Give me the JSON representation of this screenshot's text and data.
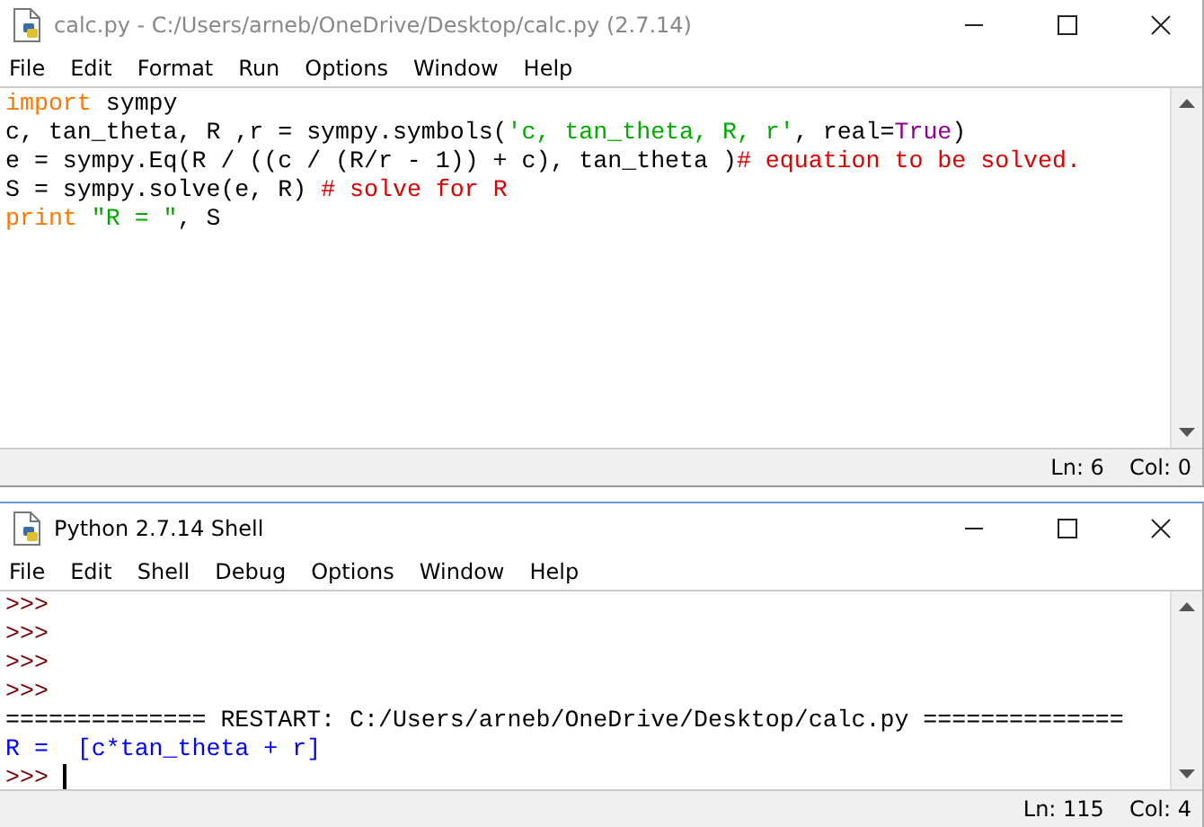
{
  "editor": {
    "title": "calc.py - C:/Users/arneb/OneDrive/Desktop/calc.py (2.7.14)",
    "menu": [
      "File",
      "Edit",
      "Format",
      "Run",
      "Options",
      "Window",
      "Help"
    ],
    "lines": [
      [
        {
          "kind": "keyword",
          "text": "import"
        },
        {
          "kind": "plain",
          "text": " sympy"
        }
      ],
      [
        {
          "kind": "plain",
          "text": "c, tan_theta, R ,r = sympy.symbols("
        },
        {
          "kind": "string",
          "text": "'c, tan_theta, R, r'"
        },
        {
          "kind": "plain",
          "text": ", real="
        },
        {
          "kind": "builtin",
          "text": "True"
        },
        {
          "kind": "plain",
          "text": ")"
        }
      ],
      [
        {
          "kind": "plain",
          "text": "e = sympy.Eq(R / ((c / (R/r - 1)) + c), tan_theta )"
        },
        {
          "kind": "comment",
          "text": "# equation to be solved."
        }
      ],
      [
        {
          "kind": "plain",
          "text": "S = sympy.solve(e, R) "
        },
        {
          "kind": "comment",
          "text": "# solve for R"
        }
      ],
      [
        {
          "kind": "keyword",
          "text": "print"
        },
        {
          "kind": "string",
          "text": " \"R = \""
        },
        {
          "kind": "plain",
          "text": ", S"
        }
      ]
    ],
    "status": [
      "Ln: 6",
      "Col: 0"
    ]
  },
  "shell": {
    "title": "Python 2.7.14 Shell",
    "menu": [
      "File",
      "Edit",
      "Shell",
      "Debug",
      "Options",
      "Window",
      "Help"
    ],
    "lines": [
      [
        {
          "kind": "prompt",
          "text": ">>>"
        }
      ],
      [
        {
          "kind": "prompt",
          "text": ">>>"
        }
      ],
      [
        {
          "kind": "prompt",
          "text": ">>>"
        }
      ],
      [
        {
          "kind": "prompt",
          "text": ">>>"
        }
      ],
      [
        {
          "kind": "plain",
          "text": "============== RESTART: C:/Users/arneb/OneDrive/Desktop/calc.py =============="
        }
      ],
      [
        {
          "kind": "output",
          "text": "R =  [c*tan_theta + r]"
        }
      ],
      [
        {
          "kind": "prompt",
          "text": ">>> "
        },
        {
          "kind": "cursor"
        }
      ]
    ],
    "status": [
      "Ln: 115",
      "Col: 4"
    ]
  }
}
